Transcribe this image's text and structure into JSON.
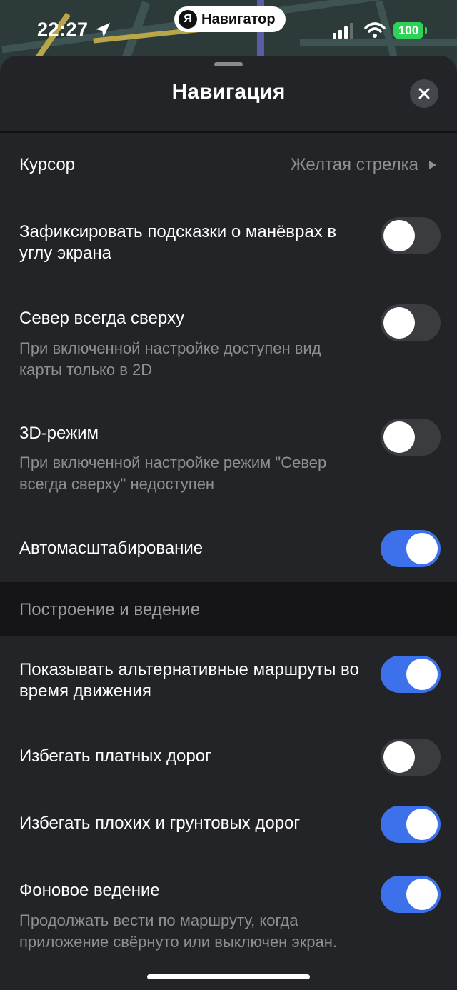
{
  "status_bar": {
    "time": "22:27",
    "app_badge": "Я",
    "app_name": "Навигатор",
    "battery": "100",
    "icons": [
      "location-arrow-icon",
      "cellular-signal-icon",
      "wifi-icon",
      "battery-icon"
    ]
  },
  "sheet": {
    "title": "Навигация",
    "close_icon": "close-icon"
  },
  "settings": {
    "cursor": {
      "label": "Курсор",
      "value": "Желтая стрелка"
    },
    "fix_hints": {
      "label": "Зафиксировать подсказки о манёврах в углу экрана",
      "on": false
    },
    "north_up": {
      "label": "Север всегда сверху",
      "subtitle": "При включенной настройке доступен вид карты только в 2D",
      "on": false
    },
    "mode_3d": {
      "label": "3D-режим",
      "subtitle": "При включенной настройке режим \"Север всегда сверху\" недоступен",
      "on": false
    },
    "autozoom": {
      "label": "Автомасштабирование",
      "on": true
    }
  },
  "routing_section": {
    "header": "Построение и ведение",
    "alt_routes": {
      "label": "Показывать альтернативные маршруты во время движения",
      "on": true
    },
    "avoid_toll": {
      "label": "Избегать платных дорог",
      "on": false
    },
    "avoid_bad_roads": {
      "label": "Избегать плохих и грунтовых дорог",
      "on": true
    },
    "background_guidance": {
      "label": "Фоновое ведение",
      "subtitle": "Продолжать вести по маршруту, когда приложение свёрнуто или выключен экран.",
      "on": true
    }
  },
  "colors": {
    "background": "#232427",
    "toggle_on": "#3d71ec",
    "toggle_off": "#3b3c40",
    "battery": "#2fd158",
    "muted_text": "#8e8f93"
  }
}
